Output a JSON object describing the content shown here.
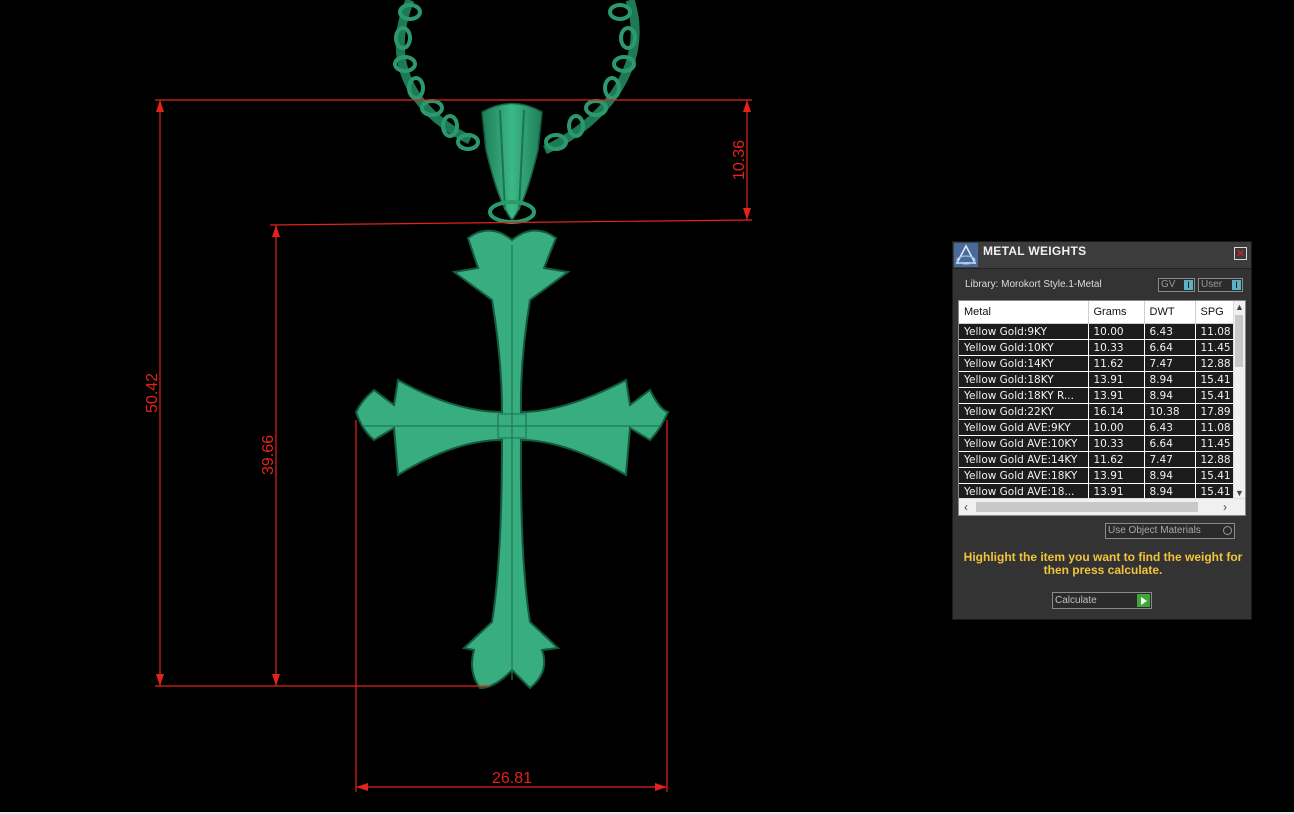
{
  "viewport": {
    "dimensions": {
      "total_height": "50.42",
      "body_height": "39.66",
      "bail_height": "10.36",
      "width": "26.81"
    }
  },
  "panel": {
    "title": "METAL WEIGHTS",
    "library_label": "Library: Morokort Style.1-Metal",
    "gv_label": "GV",
    "user_label": "User",
    "toggle_knob": "I",
    "columns": [
      "Metal",
      "Grams",
      "DWT",
      "SPG"
    ],
    "rows": [
      [
        "Yellow Gold:9KY",
        "10.00",
        "6.43",
        "11.08"
      ],
      [
        "Yellow Gold:10KY",
        "10.33",
        "6.64",
        "11.45"
      ],
      [
        "Yellow Gold:14KY",
        "11.62",
        "7.47",
        "12.88"
      ],
      [
        "Yellow Gold:18KY",
        "13.91",
        "8.94",
        "15.41"
      ],
      [
        "Yellow Gold:18KY R...",
        "13.91",
        "8.94",
        "15.41"
      ],
      [
        "Yellow Gold:22KY",
        "16.14",
        "10.38",
        "17.89"
      ],
      [
        "Yellow Gold AVE:9KY",
        "10.00",
        "6.43",
        "11.08"
      ],
      [
        "Yellow Gold AVE:10KY",
        "10.33",
        "6.64",
        "11.45"
      ],
      [
        "Yellow Gold AVE:14KY",
        "11.62",
        "7.47",
        "12.88"
      ],
      [
        "Yellow Gold AVE:18KY",
        "13.91",
        "8.94",
        "15.41"
      ],
      [
        "Yellow Gold AVE:18...",
        "13.91",
        "8.94",
        "15.41"
      ]
    ],
    "use_object_materials": "Use Object Materials",
    "hint": "Highlight the item you want to find the weight for then press calculate.",
    "calculate_label": "Calculate"
  },
  "colors": {
    "dimension_red": "#e2231a",
    "model_green": "#2f9a73",
    "hint_yellow": "#f2c43a",
    "go_green": "#3fa73a"
  }
}
